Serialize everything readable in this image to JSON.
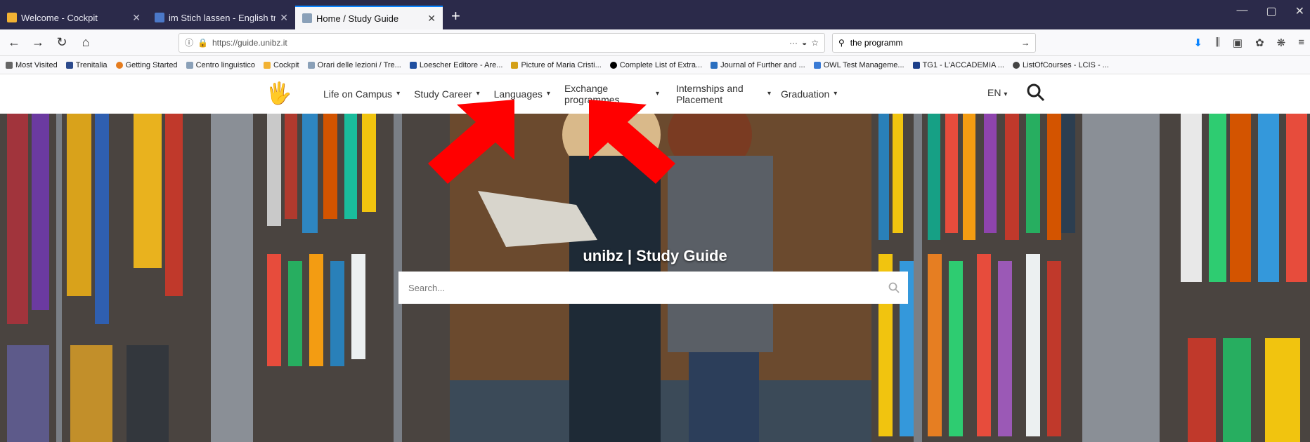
{
  "browser": {
    "tabs": [
      {
        "title": "Welcome - Cockpit",
        "active": false
      },
      {
        "title": "im Stich lassen - English transl",
        "active": false
      },
      {
        "title": "Home / Study Guide",
        "active": true
      }
    ],
    "url": "https://guide.unibz.it",
    "search_value": "the programm",
    "bookmarks": [
      "Most Visited",
      "Trenitalia",
      "Getting Started",
      "Centro linguistico",
      "Cockpit",
      "Orari delle lezioni / Tre...",
      "Loescher Editore - Are...",
      "Picture of Maria Cristi...",
      "Complete List of Extra...",
      "Journal of Further and ...",
      "OWL Test Manageme...",
      "TG1 - L'ACCADEMIA ...",
      "ListOfCourses - LCIS - ..."
    ]
  },
  "site": {
    "menu": [
      {
        "label": "Life on Campus"
      },
      {
        "label": "Study Career"
      },
      {
        "label": "Languages"
      },
      {
        "label": "Exchange programmes"
      },
      {
        "label": "Internships and Placement"
      },
      {
        "label": "Graduation"
      }
    ],
    "language": "EN",
    "hero_title": "unibz | Study Guide",
    "search_placeholder": "Search..."
  }
}
